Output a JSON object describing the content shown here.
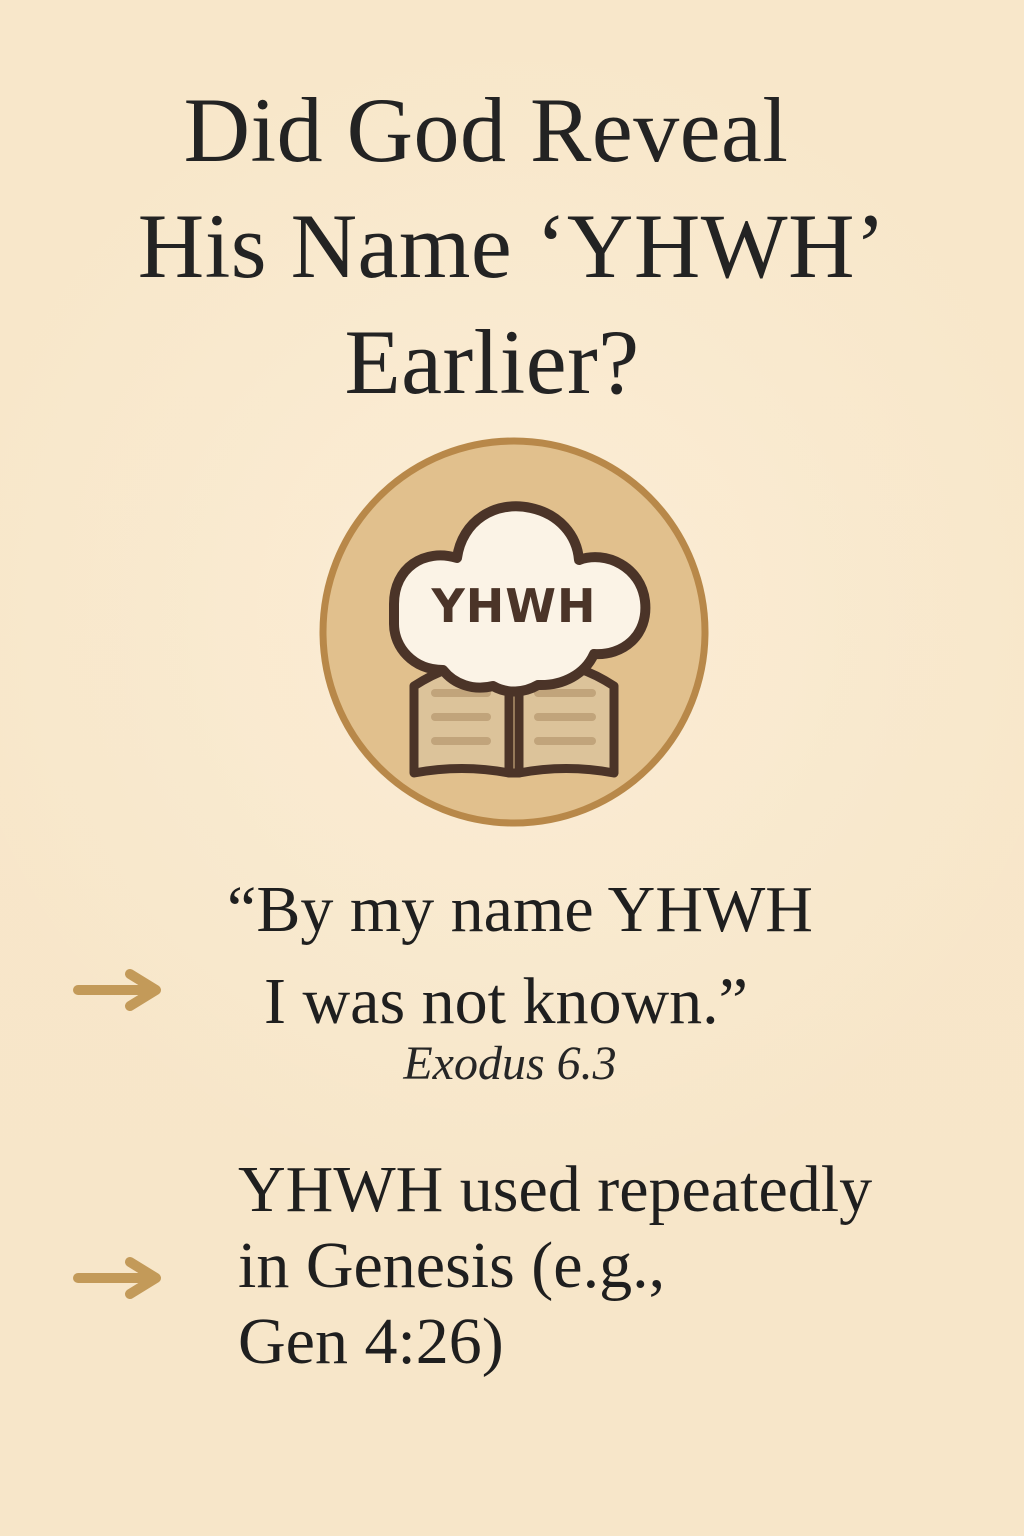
{
  "title": {
    "line1": "Did God Reveal",
    "line2": "His Name ‘YHWH’",
    "line3": "Earlier?"
  },
  "emblem": {
    "label": "YHWH",
    "icon": "cloud-book-icon"
  },
  "quote": {
    "line1": "“By my name YHWH",
    "line2": "I was not known.”",
    "reference": "Exodus 6.3"
  },
  "point": {
    "line1": "YHWH used repeatedly",
    "line2": "in Genesis (e.g.,",
    "line3": "Gen 4:26)"
  },
  "colors": {
    "background": "#f8e8cc",
    "accent": "#c39a59",
    "outline": "#4b3428",
    "text": "#1f1f1f"
  },
  "icons": {
    "arrow": "right-arrow-icon"
  }
}
